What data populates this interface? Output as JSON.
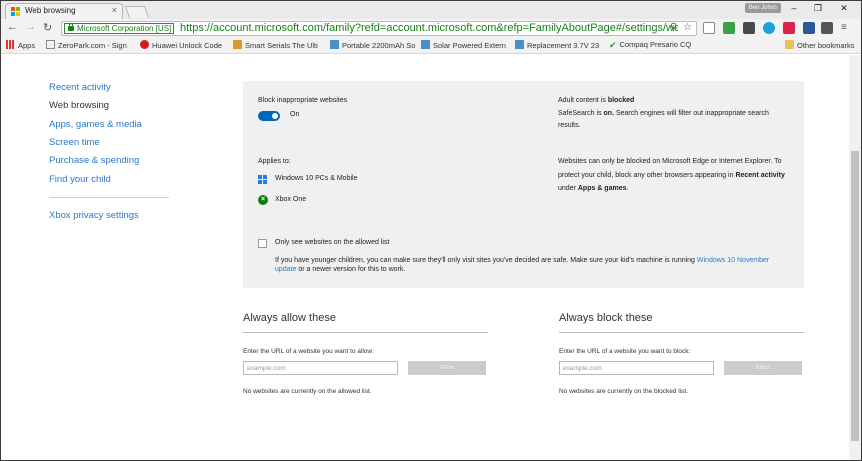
{
  "browser": {
    "tab_title": "Web browsing",
    "tab_close": "×",
    "user_badge": "Ben Johns",
    "win_minimize": "–",
    "win_restore": "❐",
    "win_close": "✕",
    "secure_label": "Microsoft Corporation [US]",
    "url": "https://account.microsoft.com/family?refd=account.microsoft.com&refp=FamilyAboutPage#/settings/web-bro",
    "bookmarks": [
      {
        "label": "Apps"
      },
      {
        "label": "ZeroPark.com - Sign"
      },
      {
        "label": "Huawei Unlock Code"
      },
      {
        "label": "Smart Serials The Ulti"
      },
      {
        "label": "Portable 2200mAh So"
      },
      {
        "label": "Solar Powered Extern"
      },
      {
        "label": "Replacement 3.7V 23"
      },
      {
        "label": "Compaq Presario CQ"
      }
    ],
    "other_bookmarks": "Other bookmarks",
    "colors": {
      "secure_green": "#1a7f1a",
      "link_blue": "#2a78c8",
      "toggle_blue": "#0067b8"
    }
  },
  "sidebar": {
    "items": [
      {
        "label": "Recent activity"
      },
      {
        "label": "Web browsing"
      },
      {
        "label": "Apps, games & media"
      },
      {
        "label": "Screen time"
      },
      {
        "label": "Purchase & spending"
      },
      {
        "label": "Find your child"
      }
    ],
    "xbox_privacy": "Xbox privacy settings"
  },
  "panel": {
    "block_label": "Block inappropriate websites",
    "toggle_state": "On",
    "adult_prefix": "Adult content is ",
    "adult_state": "blocked",
    "safesearch_prefix": "SafeSearch is ",
    "safesearch_state": "on.",
    "safesearch_rest": " Search engines will filter out inappropriate search",
    "safesearch_line2": "results.",
    "applies_to": "Applies to:",
    "device_windows": "Windows 10 PCs & Mobile",
    "device_xbox": "Xbox One",
    "edge_line1": "Websites can only be blocked on Microsoft Edge or Internet Explorer. To",
    "edge_line2_prefix": "protect your child, block any other browsers appearing in ",
    "edge_line2_bold": "Recent activity",
    "edge_line3_prefix": "under ",
    "edge_line3_bold": "Apps & games",
    "edge_line3_suffix": ".",
    "allowed_only": "Only see websites on the allowed list",
    "younger_line1": "If you have younger children, you can make sure they'll only visit sites you've decided are safe. Make sure your kid's machine is running ",
    "younger_link1": "Windows 10 November",
    "younger_link2": "update",
    "younger_line2_rest": " or a newer version for this to work."
  },
  "allow": {
    "title": "Always allow these",
    "label": "Enter the URL of a website you want to allow:",
    "placeholder": "example.com",
    "button": "Allow",
    "empty": "No websites are currently on the allowed list."
  },
  "block": {
    "title": "Always block these",
    "label": "Enter the URL of a website you want to block:",
    "placeholder": "example.com",
    "button": "Block",
    "empty": "No websites are currently on the blocked list."
  }
}
